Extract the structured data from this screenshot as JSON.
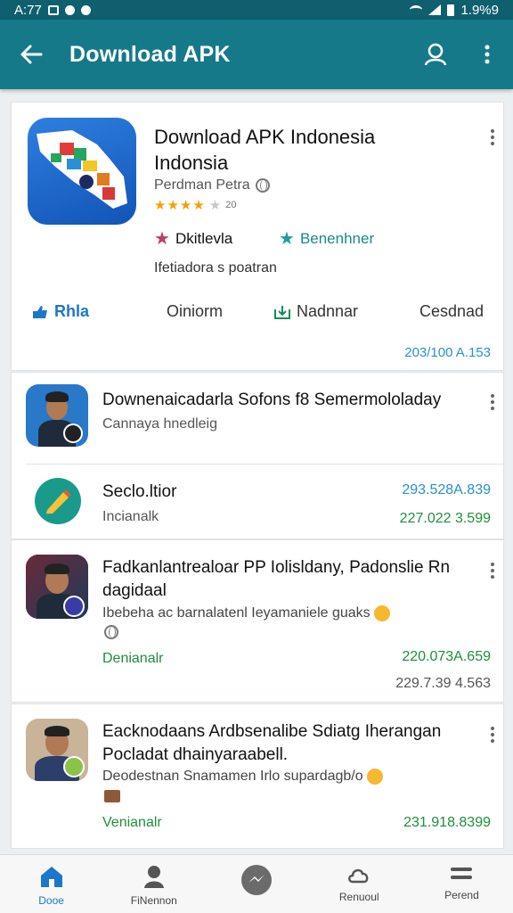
{
  "status_bar": {
    "time": "A:77",
    "battery": "1.9%9"
  },
  "app_bar": {
    "title": "Download APK"
  },
  "hero": {
    "name": "Download APK Indonesia Indonsia",
    "developer": "Perdman Petra",
    "rating_count": "20",
    "tag_left": "Dkitlevla",
    "tag_right": "Benenhner",
    "description": "Ifetiadora s poatran",
    "actions": [
      "Rhla",
      "Oiniorm",
      "Nadnnar",
      "Cesdnad"
    ],
    "size": "203/100 A.153",
    "colors": {
      "tag_left_star": "#c23a6a",
      "tag_right_star": "#1e9f9f",
      "action_blue": "#1d76c9"
    }
  },
  "list": [
    {
      "name": "Downenaicadarla Sofons f8 Semermololaday",
      "subtitle": "Cannaya hnedleig"
    },
    {
      "name": "Seclo.ltior",
      "subtitle": "Incianalk",
      "value_top": "293.528A.839",
      "value_bottom": "227.022 3.599"
    },
    {
      "name": "Fadkanlantrealoar PP Iolisldany, Padonslie Rn dagidaal",
      "subtitle": "Ibebeha ac barnalatenl Ieyamaniele guaks",
      "status": "Denianalr",
      "value_top": "220.073A.659",
      "value_bottom": "229.7.39 4.563"
    },
    {
      "name": "Eacknodaans Ardbsenalibe Sdiatg Iherangan Pocladat dhainyaraabell.",
      "subtitle": "Deodestnan Snamamen Irlo supardagb/o",
      "status": "Venianalr",
      "value_top": "231.918.8399"
    }
  ],
  "bottom_nav": [
    {
      "label": "Dooe",
      "icon": "home-icon"
    },
    {
      "label": "FiNennon",
      "icon": "person-icon"
    },
    {
      "label": "",
      "icon": "messenger-icon"
    },
    {
      "label": "Renuoul",
      "icon": "cloud-icon"
    },
    {
      "label": "Perend",
      "icon": "menu-icon"
    }
  ]
}
